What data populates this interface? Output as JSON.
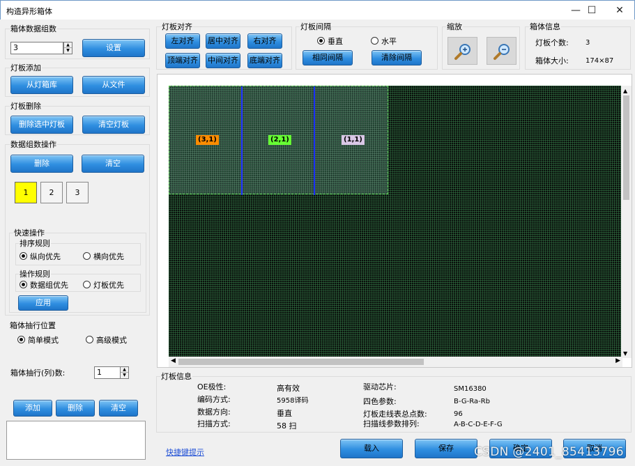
{
  "window": {
    "title": "构造异形箱体",
    "minimize": "—",
    "maximize": "☐",
    "close": "✕"
  },
  "box_data_group": {
    "title": "箱体数据组数",
    "value": "3",
    "set_label": "设置"
  },
  "panel_add": {
    "title": "灯板添加",
    "from_library": "从灯箱库",
    "from_file": "从文件"
  },
  "panel_delete": {
    "title": "灯板删除",
    "delete_selected": "删除选中灯板",
    "clear_all": "清空灯板"
  },
  "data_group_ops": {
    "title": "数据组数操作",
    "delete_label": "删除",
    "clear_label": "清空",
    "tiles": [
      "1",
      "2",
      "3"
    ],
    "selected_tile": "1",
    "quick": {
      "title": "快速操作",
      "sort_title": "排序规则",
      "sort_options": [
        "纵向优先",
        "横向优先"
      ],
      "sort_selected": "纵向优先",
      "op_title": "操作规则",
      "op_options": [
        "数据组优先",
        "灯板优先"
      ],
      "op_selected": "数据组优先",
      "apply_label": "应用"
    }
  },
  "extract": {
    "title": "箱体抽行位置",
    "modes": [
      "简单模式",
      "高级模式"
    ],
    "mode_selected": "简单模式",
    "rows_label": "箱体抽行(列)数:",
    "rows_value": "1",
    "add_label": "添加",
    "delete_label": "删除",
    "clear_label": "清空"
  },
  "align": {
    "title": "灯板对齐",
    "buttons": [
      "左对齐",
      "居中对齐",
      "右对齐",
      "顶端对齐",
      "中间对齐",
      "底端对齐"
    ]
  },
  "spacing": {
    "title": "灯板间隔",
    "options": [
      "垂直",
      "水平"
    ],
    "selected": "垂直",
    "same_label": "相同间隔",
    "clear_label": "清除间隔"
  },
  "zoom": {
    "title": "缩放",
    "zoom_in_icon": "zoom-in-icon",
    "zoom_out_icon": "zoom-out-icon"
  },
  "box_info": {
    "title": "箱体信息",
    "count_label": "灯板个数:",
    "count_value": "3",
    "size_label": "箱体大小:",
    "size_value": "174×87"
  },
  "canvas": {
    "panels": [
      {
        "label": "(3,1)",
        "color": "#ff8c00"
      },
      {
        "label": "(2,1)",
        "color": "#66ff33"
      },
      {
        "label": "(1,1)",
        "color": "#d9c7e6"
      }
    ]
  },
  "panel_info": {
    "title": "灯板信息",
    "left": [
      {
        "k": "OE极性:",
        "v": "高有效"
      },
      {
        "k": "编码方式:",
        "v": "5958译码"
      },
      {
        "k": "数据方向:",
        "v": "垂直"
      },
      {
        "k": "扫描方式:",
        "v": "58 扫"
      }
    ],
    "right": [
      {
        "k": "驱动芯片:",
        "v": "SM16380"
      },
      {
        "k": "四色参数:",
        "v": "B-G-Ra-Rb"
      },
      {
        "k": "灯板走线表总点数:",
        "v": "96"
      },
      {
        "k": "扫描线参数排列:",
        "v": "A-B-C-D-E-F-G"
      }
    ]
  },
  "footer": {
    "shortcut_link": "快捷键提示",
    "load_label": "载入",
    "save_label": "保存",
    "ok_label": "确定",
    "cancel_label": "取消"
  },
  "watermark": "CSDN @2401_85413796"
}
